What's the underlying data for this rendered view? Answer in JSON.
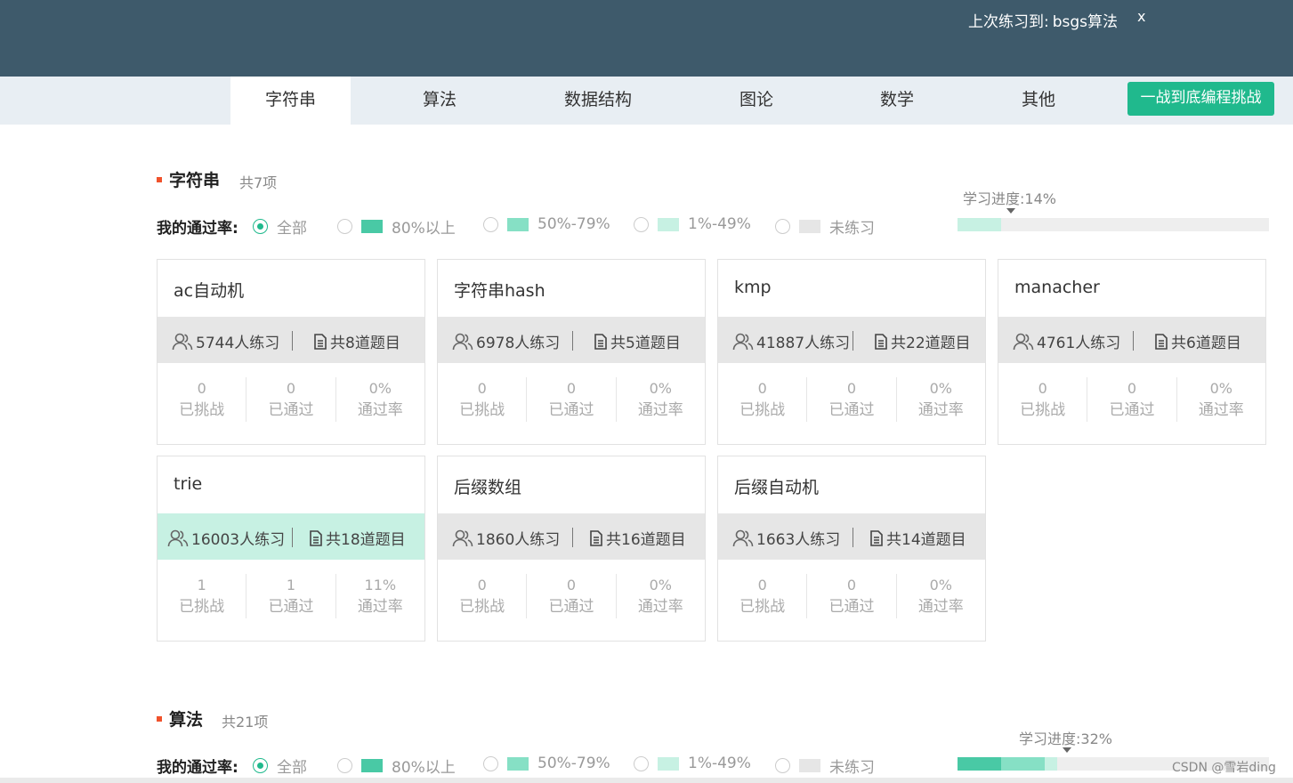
{
  "header": {
    "last_practice_label": "上次练习到:",
    "last_practice_topic": "bsgs算法",
    "close_label": "x"
  },
  "nav": {
    "tabs": [
      {
        "label": "字符串",
        "active": true
      },
      {
        "label": "算法"
      },
      {
        "label": "数据结构"
      },
      {
        "label": "图论"
      },
      {
        "label": "数学"
      },
      {
        "label": "其他"
      }
    ],
    "challenge_button": "一战到底编程挑战"
  },
  "sections": [
    {
      "title": "字符串",
      "count": "共7项",
      "filter": {
        "label": "我的通过率:",
        "options": [
          {
            "label": "全部",
            "checked": true
          },
          {
            "label": "80%以上",
            "color": "#49c9a5"
          },
          {
            "label": "50%-79%",
            "color": "#86e0c5"
          },
          {
            "label": "1%-49%",
            "color": "#c7f1e3"
          },
          {
            "label": "未练习",
            "color": "#e6e6e6"
          }
        ]
      },
      "progress": {
        "label": "学习进度:14%",
        "segments": [
          {
            "color": "#c7f1e3",
            "fraction": 0.14
          }
        ]
      },
      "cards": [
        {
          "name": "ac自动机",
          "people": "5744人练习",
          "problems": "共8道题目",
          "challenged": "0",
          "challenged_label": "已挑战",
          "passed": "0",
          "passed_label": "已通过",
          "rate": "0%",
          "rate_label": "通过率"
        },
        {
          "name": "字符串hash",
          "people": "6978人练习",
          "problems": "共5道题目",
          "challenged": "0",
          "challenged_label": "已挑战",
          "passed": "0",
          "passed_label": "已通过",
          "rate": "0%",
          "rate_label": "通过率"
        },
        {
          "name": "kmp",
          "people": "41887人练习",
          "problems": "共22道题目",
          "challenged": "0",
          "challenged_label": "已挑战",
          "passed": "0",
          "passed_label": "已通过",
          "rate": "0%",
          "rate_label": "通过率"
        },
        {
          "name": "manacher",
          "people": "4761人练习",
          "problems": "共6道题目",
          "challenged": "0",
          "challenged_label": "已挑战",
          "passed": "0",
          "passed_label": "已通过",
          "rate": "0%",
          "rate_label": "通过率"
        },
        {
          "name": "trie",
          "people": "16003人练习",
          "problems": "共18道题目",
          "challenged": "1",
          "challenged_label": "已挑战",
          "passed": "1",
          "passed_label": "已通过",
          "rate": "11%",
          "rate_label": "通过率",
          "highlight": true
        },
        {
          "name": "后缀数组",
          "people": "1860人练习",
          "problems": "共16道题目",
          "challenged": "0",
          "challenged_label": "已挑战",
          "passed": "0",
          "passed_label": "已通过",
          "rate": "0%",
          "rate_label": "通过率"
        },
        {
          "name": "后缀自动机",
          "people": "1663人练习",
          "problems": "共14道题目",
          "challenged": "0",
          "challenged_label": "已挑战",
          "passed": "0",
          "passed_label": "已通过",
          "rate": "0%",
          "rate_label": "通过率"
        }
      ]
    },
    {
      "title": "算法",
      "count": "共21项",
      "filter": {
        "label": "我的通过率:",
        "options": [
          {
            "label": "全部",
            "checked": true
          },
          {
            "label": "80%以上",
            "color": "#49c9a5"
          },
          {
            "label": "50%-79%",
            "color": "#86e0c5"
          },
          {
            "label": "1%-49%",
            "color": "#c7f1e3"
          },
          {
            "label": "未练习",
            "color": "#e6e6e6"
          }
        ]
      },
      "progress": {
        "label": "学习进度:32%",
        "segments": [
          {
            "color": "#49c9a5",
            "fraction": 0.14
          },
          {
            "color": "#86e0c5",
            "fraction": 0.14
          },
          {
            "color": "#c7f1e3",
            "fraction": 0.04
          }
        ]
      }
    }
  ],
  "watermark": "CSDN @雪岩ding"
}
